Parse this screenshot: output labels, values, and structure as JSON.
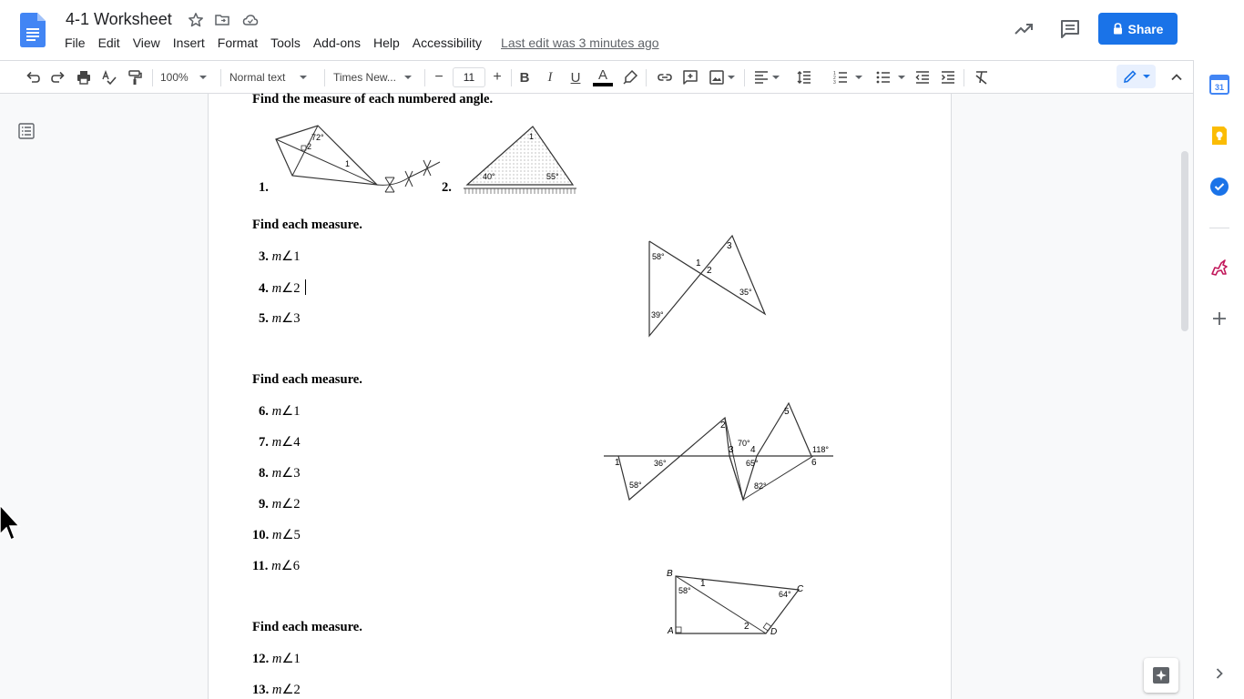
{
  "document": {
    "title": "4-1 Worksheet",
    "last_edit": "Last edit was 3 minutes ago"
  },
  "menu": [
    "File",
    "Edit",
    "View",
    "Insert",
    "Format",
    "Tools",
    "Add-ons",
    "Help",
    "Accessibility"
  ],
  "header": {
    "share_label": "Share"
  },
  "toolbar": {
    "zoom": "100%",
    "style": "Normal text",
    "font": "Times New...",
    "font_size": "11",
    "minus": "−",
    "plus": "+",
    "bold": "B",
    "italic": "I",
    "underline": "U",
    "text_color_letter": "A"
  },
  "colors": {
    "accent": "#1a73e8",
    "calendar": "#4285f4",
    "keep": "#fbbc04",
    "tasks": "#1a73e8",
    "addon": "#c2185b"
  },
  "content": {
    "section1": {
      "heading": "Find the measure of each numbered angle.",
      "items": [
        {
          "num": "1."
        },
        {
          "num": "2."
        }
      ],
      "fig1_labels": [
        "72°",
        "2",
        "1"
      ],
      "fig2_labels": [
        "1",
        "40°",
        "55°"
      ]
    },
    "section2": {
      "heading": "Find each measure.",
      "items": [
        {
          "num": "3.",
          "m": "m",
          "angle": "∠1"
        },
        {
          "num": "4.",
          "m": "m",
          "angle": "∠2"
        },
        {
          "num": "5.",
          "m": "m",
          "angle": "∠3"
        }
      ],
      "fig_labels": [
        "58°",
        "1",
        "2",
        "3",
        "35°",
        "39°"
      ]
    },
    "section3": {
      "heading": "Find each measure.",
      "items": [
        {
          "num": "6.",
          "m": "m",
          "angle": "∠1"
        },
        {
          "num": "7.",
          "m": "m",
          "angle": "∠4"
        },
        {
          "num": "8.",
          "m": "m",
          "angle": "∠3"
        },
        {
          "num": "9.",
          "m": "m",
          "angle": "∠2"
        },
        {
          "num": "10.",
          "m": "m",
          "angle": "∠5"
        },
        {
          "num": "11.",
          "m": "m",
          "angle": "∠6"
        }
      ],
      "fig_labels": [
        "1",
        "36°",
        "58°",
        "2",
        "3",
        "70°",
        "4",
        "65°",
        "82°",
        "5",
        "118°",
        "6"
      ]
    },
    "section4": {
      "heading": "Find each measure.",
      "items": [
        {
          "num": "12.",
          "m": "m",
          "angle": "∠1"
        },
        {
          "num": "13.",
          "m": "m",
          "angle": "∠2"
        }
      ],
      "fig_labels": [
        "B",
        "58°",
        "1",
        "64°",
        "C",
        "A",
        "2",
        "D"
      ]
    }
  }
}
